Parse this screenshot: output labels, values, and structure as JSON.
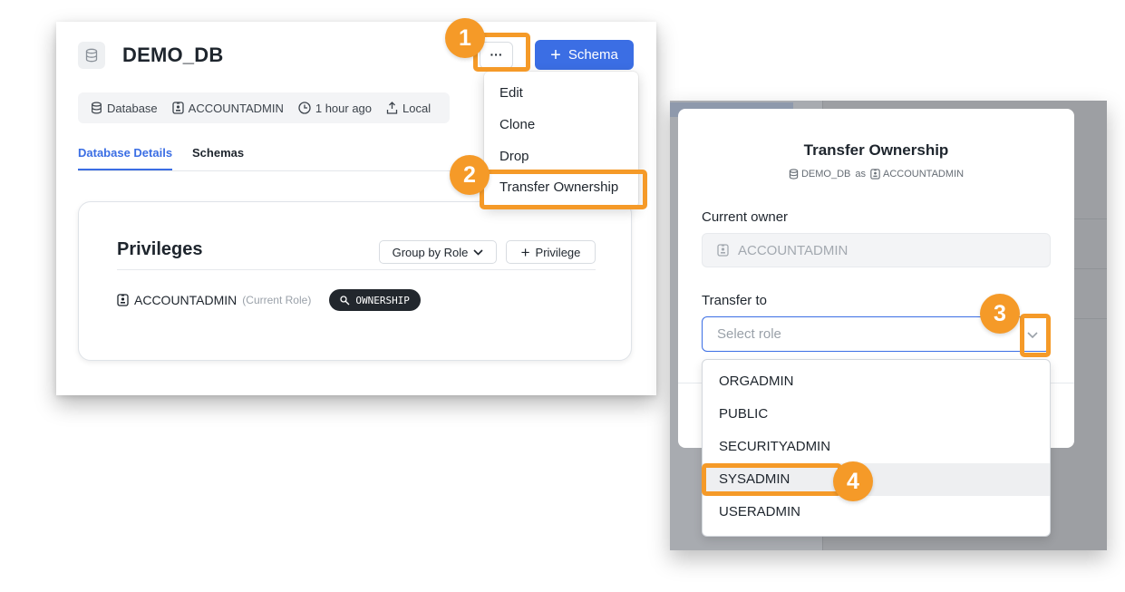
{
  "database": {
    "title": "DEMO_DB",
    "more_label": "···",
    "add_schema_label": "Schema",
    "meta": {
      "type": "Database",
      "owner": "ACCOUNTADMIN",
      "time": "1 hour ago",
      "location": "Local"
    },
    "tabs": [
      {
        "label": "Database Details",
        "active": true
      },
      {
        "label": "Schemas",
        "active": false
      }
    ],
    "privileges": {
      "title": "Privileges",
      "group_by_label": "Group by Role",
      "add_label": "Privilege",
      "rows": [
        {
          "role": "ACCOUNTADMIN",
          "note": "(Current Role)",
          "privilege": "OWNERSHIP"
        }
      ]
    }
  },
  "menu": {
    "items": [
      "Edit",
      "Clone",
      "Drop",
      "Transfer Ownership"
    ]
  },
  "modal": {
    "title": "Transfer Ownership",
    "subtitle_db": "DEMO_DB",
    "subtitle_as": "as",
    "subtitle_role": "ACCOUNTADMIN",
    "current_owner_label": "Current owner",
    "current_owner_value": "ACCOUNTADMIN",
    "transfer_to_label": "Transfer to",
    "select_placeholder": "Select role",
    "options": [
      "ORGADMIN",
      "PUBLIC",
      "SECURITYADMIN",
      "SYSADMIN",
      "USERADMIN"
    ],
    "hovered_option": "SYSADMIN"
  },
  "callouts": [
    "1",
    "2",
    "3",
    "4"
  ],
  "colors": {
    "accent": "#3b6ee4",
    "callout": "#f59a28",
    "badge_dark": "#22272d"
  },
  "icons": [
    "database-icon",
    "role-icon",
    "clock-icon",
    "location-icon",
    "search-key-icon",
    "chevron-down-icon",
    "plus-icon"
  ]
}
